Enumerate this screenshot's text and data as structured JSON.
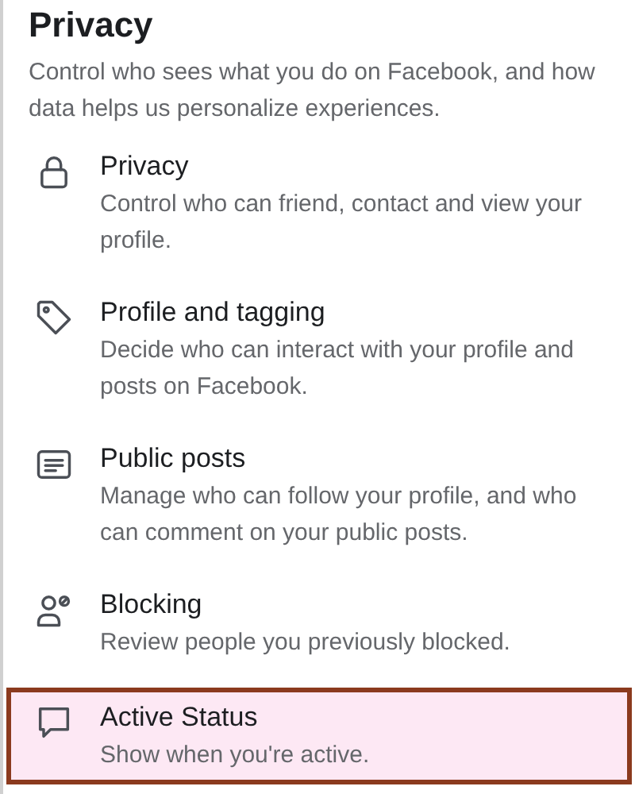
{
  "header": {
    "title": "Privacy",
    "description": "Control who sees what you do on Facebook, and how data helps us personalize experiences."
  },
  "items": [
    {
      "title": "Privacy",
      "description": "Control who can friend, contact and view your profile.",
      "selected": false
    },
    {
      "title": "Profile and tagging",
      "description": "Decide who can interact with your profile and posts on Facebook.",
      "selected": false
    },
    {
      "title": "Public posts",
      "description": "Manage who can follow your profile, and who can comment on your public posts.",
      "selected": false
    },
    {
      "title": "Blocking",
      "description": "Review people you previously blocked.",
      "selected": false
    },
    {
      "title": "Active Status",
      "description": "Show when you're active.",
      "selected": true
    }
  ]
}
